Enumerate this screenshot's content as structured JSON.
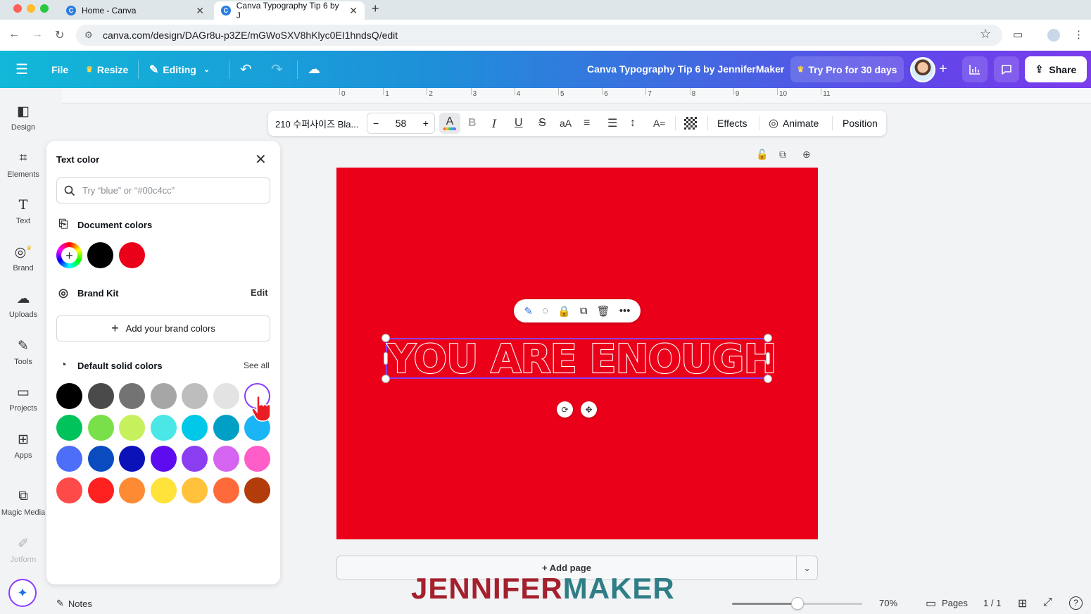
{
  "browser": {
    "tabs": [
      {
        "title": "Home - Canva",
        "active": false
      },
      {
        "title": "Canva Typography Tip 6 by J",
        "active": true
      }
    ],
    "url": "canva.com/design/DAGr8u-p3ZE/mGWoSXV8hKlyc0EI1hndsQ/edit"
  },
  "header": {
    "file_label": "File",
    "resize_label": "Resize",
    "editing_label": "Editing",
    "design_title": "Canva Typography Tip 6 by JenniferMaker",
    "try_pro_label": "Try Pro for 30 days",
    "share_label": "Share"
  },
  "rail": [
    {
      "label": "Design",
      "icon": "design-icon"
    },
    {
      "label": "Elements",
      "icon": "elements-icon"
    },
    {
      "label": "Text",
      "icon": "text-icon"
    },
    {
      "label": "Brand",
      "icon": "brand-icon"
    },
    {
      "label": "Uploads",
      "icon": "uploads-icon"
    },
    {
      "label": "Tools",
      "icon": "tools-icon"
    },
    {
      "label": "Projects",
      "icon": "projects-icon"
    },
    {
      "label": "Apps",
      "icon": "apps-icon"
    },
    {
      "label": "Magic Media",
      "icon": "magic-media-icon"
    },
    {
      "label": "Jotform",
      "icon": "jotform-icon"
    }
  ],
  "panel": {
    "title": "Text color",
    "search_placeholder": "Try “blue” or “#00c4cc”",
    "document_colors_label": "Document colors",
    "document_colors": [
      "#000000",
      "#ea0018"
    ],
    "brand_kit_label": "Brand Kit",
    "brand_kit_edit": "Edit",
    "add_brand_label": "Add your brand colors",
    "default_colors_label": "Default solid colors",
    "see_all_label": "See all",
    "default_colors": [
      [
        "#000000",
        "#4a4a4a",
        "#737373",
        "#a6a6a6",
        "#bdbdbd",
        "#e3e3e3",
        "#ffffff"
      ],
      [
        "#00c35b",
        "#7ae04a",
        "#c6f05c",
        "#4be6e6",
        "#00c8e8",
        "#00a0c6",
        "#1ab5f5"
      ],
      [
        "#4c6ef8",
        "#0a4bc0",
        "#0a12b8",
        "#5d0cf0",
        "#8b3df2",
        "#d565f0",
        "#ff5ec9"
      ],
      [
        "#ff4a4a",
        "#ff2020",
        "#ff8a34",
        "#ffe33a",
        "#ffc23a",
        "#ff6a3a",
        "#b23d0a"
      ]
    ]
  },
  "toolbar": {
    "font_name": "210 수퍼사이즈 Bla...",
    "font_size": "58",
    "effects_label": "Effects",
    "animate_label": "Animate",
    "position_label": "Position"
  },
  "ruler_ticks": [
    "0",
    "1",
    "2",
    "3",
    "4",
    "5",
    "6",
    "7",
    "8",
    "9",
    "10",
    "11"
  ],
  "canvas": {
    "background": "#ea0018",
    "text": "YOU ARE ENOUGH"
  },
  "add_page_label": "+ Add page",
  "watermark": {
    "part1": "JENNIFER",
    "part2": "MAKER"
  },
  "bottom": {
    "notes_label": "Notes",
    "zoom": "70%",
    "zoom_level": 0.5,
    "pages_label": "Pages",
    "page_count": "1 / 1"
  }
}
